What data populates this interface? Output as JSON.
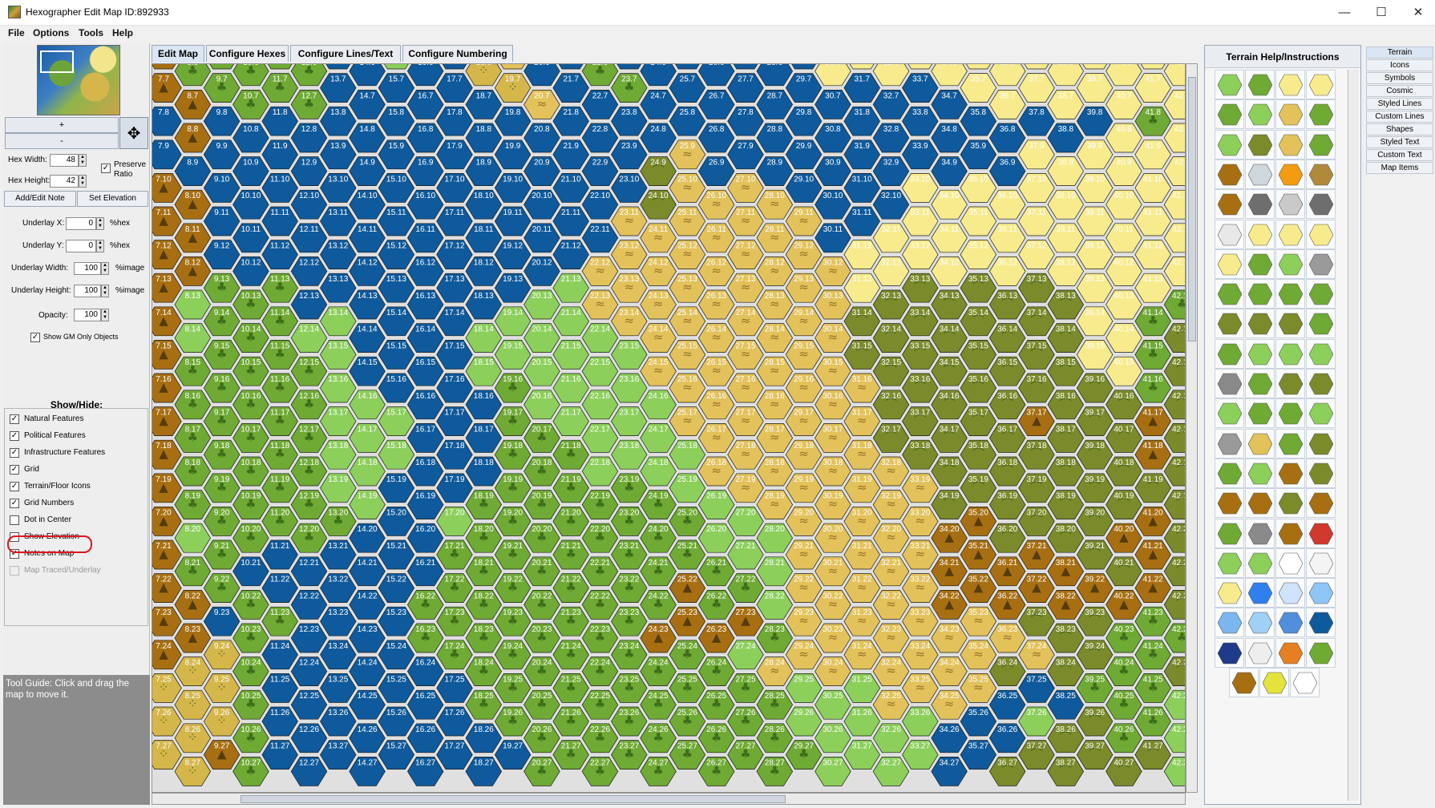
{
  "window": {
    "title": "Hexographer Edit Map ID:892933",
    "minimize": "—",
    "maximize": "☐",
    "close": "✕"
  },
  "menu": [
    "File",
    "Options",
    "Tools",
    "Help"
  ],
  "left": {
    "zoom_in": "+",
    "zoom_out": "-",
    "hex_width_label": "Hex Width:",
    "hex_width": "48",
    "hex_height_label": "Hex Height:",
    "hex_height": "42",
    "preserve_ratio": "Preserve Ratio",
    "add_note": "Add/Edit Note",
    "set_elevation": "Set Elevation",
    "underlay_x_label": "Underlay X:",
    "underlay_x": "0",
    "underlay_x_unit": "%hex",
    "underlay_y_label": "Underlay Y:",
    "underlay_y": "0",
    "underlay_y_unit": "%hex",
    "underlay_w_label": "Underlay Width:",
    "underlay_w": "100",
    "underlay_w_unit": "%image",
    "underlay_h_label": "Underlay Height:",
    "underlay_h": "100",
    "underlay_h_unit": "%image",
    "opacity_label": "Opacity:",
    "opacity": "100",
    "gm_only": "Show GM Only Objects",
    "showhide_title": "Show/Hide:",
    "showhide": [
      {
        "label": "Natural Features",
        "checked": true
      },
      {
        "label": "Political Features",
        "checked": true
      },
      {
        "label": "Infrastructure Features",
        "checked": true
      },
      {
        "label": "Grid",
        "checked": true
      },
      {
        "label": "Terrain/Floor Icons",
        "checked": true
      },
      {
        "label": "Grid Numbers",
        "checked": true
      },
      {
        "label": "Dot in Center",
        "checked": false
      },
      {
        "label": "Show Elevation",
        "checked": false
      },
      {
        "label": "Notes on Map",
        "checked": true
      },
      {
        "label": "Map Traced/Underlay",
        "checked": false
      }
    ],
    "tool_guide": "Tool Guide: Click and drag the map to move it."
  },
  "tabs": [
    "Edit Map",
    "Configure Hexes",
    "Configure Lines/Text",
    "Configure Numbering"
  ],
  "palette_title": "Terrain Help/Instructions",
  "categories": [
    "Terrain",
    "Icons",
    "Symbols",
    "Cosmic",
    "Styled Lines",
    "Custom Lines",
    "Shapes",
    "Styled Text",
    "Custom Text",
    "Map Items"
  ],
  "colors": {
    "water": "#0f5a9c",
    "grass": "#8ccf5b",
    "forest": "#6faa34",
    "hills": "#7b8a2b",
    "mountains": "#a76f12",
    "desert": "#e3c25b",
    "sand": "#f7eb8e",
    "swamp": "#d4b64a"
  },
  "map": {
    "first_column": 7,
    "first_row": 6,
    "columns": 36,
    "rows": 22,
    "terrain_legend": "W=water G=grass F=forest H=hills M=mountains D=dunes S=sand Y=sandy-scrub",
    "rows_terrain": [
      "MFFFFFWWGWWYDWWFWWWWWWWSSSSSSSSSSSSSS",
      "MMFFFFWWWWWWYDWWFWWWWWWWWWWWSSSSSSSS",
      "WMWWWWWWWWWWWWWWWWWWWWWWWWWWWWWWWSFSS",
      "WWWWWWWWWWWWWWWWWHDWWWWWWWWWWWSSSSSSS",
      "MMWWWWWWWWWWWWWWWHDDDDWWWWSSSSSSSSSSS",
      "MMWWWWWWWWWWWWWWDDDDDDDWWSSSSSSSSSSSS",
      "MMWWWWWWWWWWWWWDDDDDDDDDSSSSSSSSSSSSS",
      "MGFFFWWWWWWWWGGDDDDDDDDDSHHHHHHHSSSFH",
      "MGFFFGGWWWWGGGGGDDDDDDDDHHHHHHHHSSFHH",
      "MFFFFFGWWWWGGGGGGDDDDDDDHHHHHHHHSSFHH",
      "MFFFFFGGWWWWFGGGGGDDDDDDDHHHHHHHHHFHF",
      "MFFFFFGGGWWWFFGGGGDDDDDDDHHHHHMHHHMHF",
      "MFFFFFGGGWWWFFFGGGGDDDDDDDHHHHHHHHMHF",
      "MFFFFFGGWWWFFFFFFFGGDDDDDDDHHHHHHHHHF",
      "MGFFFFFWWWGFFFFFFFFGGGDDDDDMMHHHHMMHF",
      "MFFWWWWWWWFFFFFFFFFFGGDDDDDMMMMMHHMHM",
      "MMFFWWWWWFFFFFFFFFMFFGDDDDDMMMMMMMMHM",
      "MMWFFWWWWFFFFFFFFMMMMFDDDDDDDDHHHFFFG",
      "MYYFWWWWWWFFFFFFFFFFGDDDDDDDDHDHHFFHG",
      "YYYFWWWWWWWFFFFFFFFFFFGGGDDDDWWWFFFGG",
      "YYYFWWWWWWWWFFFFFFFFFFGGGGGWWWGHHFFGF",
      "YYMFWWWWWWWWWFFFFFFFFFFGGGGWWHHHHHHGG"
    ]
  }
}
